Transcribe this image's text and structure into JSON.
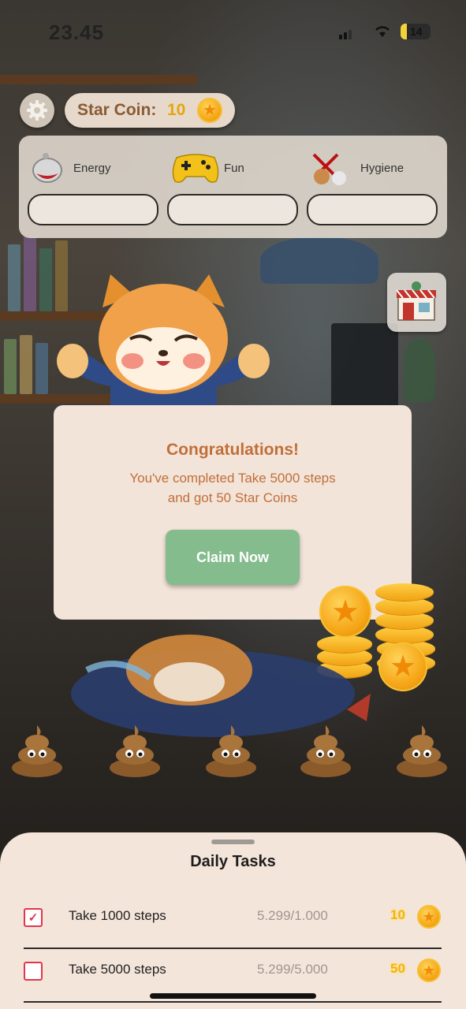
{
  "status_bar": {
    "time": "23.45",
    "battery": "14"
  },
  "top_bar": {
    "coin_label": "Star Coin:",
    "coin_value": "10"
  },
  "stats": [
    {
      "label": "Energy",
      "icon": "meat-icon"
    },
    {
      "label": "Fun",
      "icon": "gamepad-icon"
    },
    {
      "label": "Hygiene",
      "icon": "broom-icon"
    }
  ],
  "dialog": {
    "title": "Congratulations!",
    "message_line1": "You've completed Take 5000 steps",
    "message_line2": "and got 50 Star Coins",
    "button": "Claim Now"
  },
  "daily_tasks": {
    "title": "Daily Tasks",
    "items": [
      {
        "checked": true,
        "name": "Take 1000 steps",
        "progress": "5.299/1.000",
        "reward": "10"
      },
      {
        "checked": false,
        "name": "Take 5000 steps",
        "progress": "5.299/5.000",
        "reward": "50"
      }
    ]
  },
  "colors": {
    "accent_title": "#c06f39",
    "claim_button": "#84bc8d",
    "coin": "#f5a516",
    "checkbox": "#e2364d"
  }
}
